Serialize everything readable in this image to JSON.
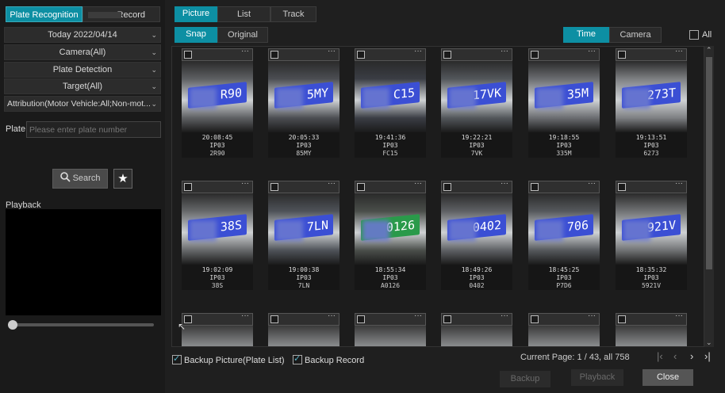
{
  "left": {
    "tabs": [
      {
        "label": "Plate Recognition"
      },
      {
        "label": "Record"
      }
    ],
    "date": "Today 2022/04/14",
    "camera": "Camera(All)",
    "detection": "Plate Detection",
    "target": "Target(All)",
    "attribution": "Attribution(Motor Vehicle:All;Non-mot...",
    "plate_label": "Plate",
    "plate_placeholder": "Please enter plate number",
    "search_label": "Search",
    "playback_label": "Playback"
  },
  "right": {
    "view_tabs": [
      "Picture",
      "List",
      "Track"
    ],
    "type_tabs": [
      "Snap",
      "Original"
    ],
    "sort_tabs": [
      "Time",
      "Camera"
    ],
    "all_label": "All",
    "cards": [
      {
        "time": "20:08:45",
        "cam": "IP03",
        "plate": "2R90",
        "img_text": "R90",
        "bg": "#5d5f62",
        "plate_bg": "#3b4fd4"
      },
      {
        "time": "20:05:33",
        "cam": "IP03",
        "plate": "85MY",
        "img_text": "5MY",
        "bg": "#4b4d52",
        "plate_bg": "#3b4fd4"
      },
      {
        "time": "19:41:36",
        "cam": "IP03",
        "plate": "FC15",
        "img_text": "C15",
        "bg": "#3a3d44",
        "plate_bg": "#3b4fd4"
      },
      {
        "time": "19:22:21",
        "cam": "IP03",
        "plate": "7VK",
        "img_text": "17VK",
        "bg": "#52565a",
        "plate_bg": "#3b4fd4"
      },
      {
        "time": "19:18:55",
        "cam": "IP03",
        "plate": "335M",
        "img_text": "35M",
        "bg": "#6a6c70",
        "plate_bg": "#3b4fd4"
      },
      {
        "time": "19:13:51",
        "cam": "IP03",
        "plate": "6273",
        "img_text": "273T",
        "bg": "#7d7f82",
        "plate_bg": "#3b4fd4"
      },
      {
        "time": "19:02:09",
        "cam": "IP03",
        "plate": "38S",
        "img_text": "38S",
        "bg": "#66686a",
        "plate_bg": "#3b4fd4"
      },
      {
        "time": "19:00:38",
        "cam": "IP03",
        "plate": "7LN",
        "img_text": "7LN",
        "bg": "#4e5258",
        "plate_bg": "#3b4fd4"
      },
      {
        "time": "18:55:34",
        "cam": "IP03",
        "plate": "A0126",
        "img_text": "0126",
        "bg": "#4a4e4a",
        "plate_bg": "#2a9a4a"
      },
      {
        "time": "18:49:26",
        "cam": "IP03",
        "plate": "0402",
        "img_text": "0402",
        "bg": "#5e6064",
        "plate_bg": "#3b4fd4"
      },
      {
        "time": "18:45:25",
        "cam": "IP03",
        "plate": "P7D6",
        "img_text": "706",
        "bg": "#55585c",
        "plate_bg": "#3b4fd4"
      },
      {
        "time": "18:35:32",
        "cam": "IP03",
        "plate": "5921V",
        "img_text": "921V",
        "bg": "#707274",
        "plate_bg": "#3b4fd4"
      }
    ],
    "backup_picture_label": "Backup Picture(Plate List)",
    "backup_record_label": "Backup Record",
    "page_info": "Current Page: 1 / 43, all 758",
    "backup_btn": "Backup",
    "playback_btn": "Playback",
    "close_btn": "Close"
  }
}
